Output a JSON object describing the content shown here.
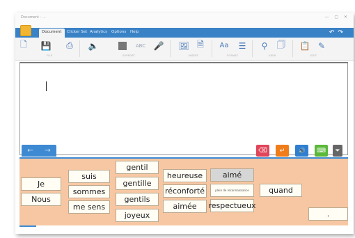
{
  "titlebar": {
    "title": "Document - ...",
    "window_buttons": "— ▢ ✕"
  },
  "menu": {
    "tabs": [
      "Document",
      "Clicker Set",
      "Analytics",
      "Options",
      "Help"
    ],
    "active": "Document",
    "undo_icon": "undo-icon",
    "redo_icon": "redo-icon"
  },
  "ribbon": {
    "groups": [
      "FILE",
      "SUPPORT",
      "INSERT",
      "FORMAT",
      "VIEW",
      "EDIT"
    ],
    "icons": [
      "new-document-icon",
      "save-icon",
      "print-icon",
      "speaker-icon",
      "stop-icon",
      "spell-check-icon",
      "microphone-icon",
      "insert-image-icon",
      "insert-page-icon",
      "font-icon",
      "align-icon",
      "search-icon",
      "view-page-icon",
      "paste-icon",
      "edit-icon"
    ]
  },
  "toolbar": {
    "prev_label": "←",
    "next_label": "→",
    "delete_glyph": "⌫",
    "enter_glyph": "↵",
    "speak_glyph": "🔊",
    "keyboard_glyph": "⌨",
    "more_glyph": "⏷",
    "colors": {
      "delete": "#e0455a",
      "enter": "#f07c1a",
      "speak": "#2f7fd0",
      "keyboard": "#5bb83a",
      "more": "#666666"
    }
  },
  "grid": {
    "col1": [
      "Je",
      "Nous"
    ],
    "col2": [
      "suis",
      "sommes",
      "me sens"
    ],
    "col3": [
      "gentil",
      "gentille",
      "gentils",
      "joyeux"
    ],
    "col4": [
      "heureuse",
      "réconforté",
      "aimée"
    ],
    "col5": [
      "aimé",
      "plein de reconnaissance",
      "respectueux"
    ],
    "col6": [
      "quand"
    ],
    "punct": ".",
    "selected": "aimé",
    "colors": {
      "background": "#f7c7a3",
      "cell": "#fffdf4",
      "selected_cell": "#d6d6d6"
    }
  }
}
